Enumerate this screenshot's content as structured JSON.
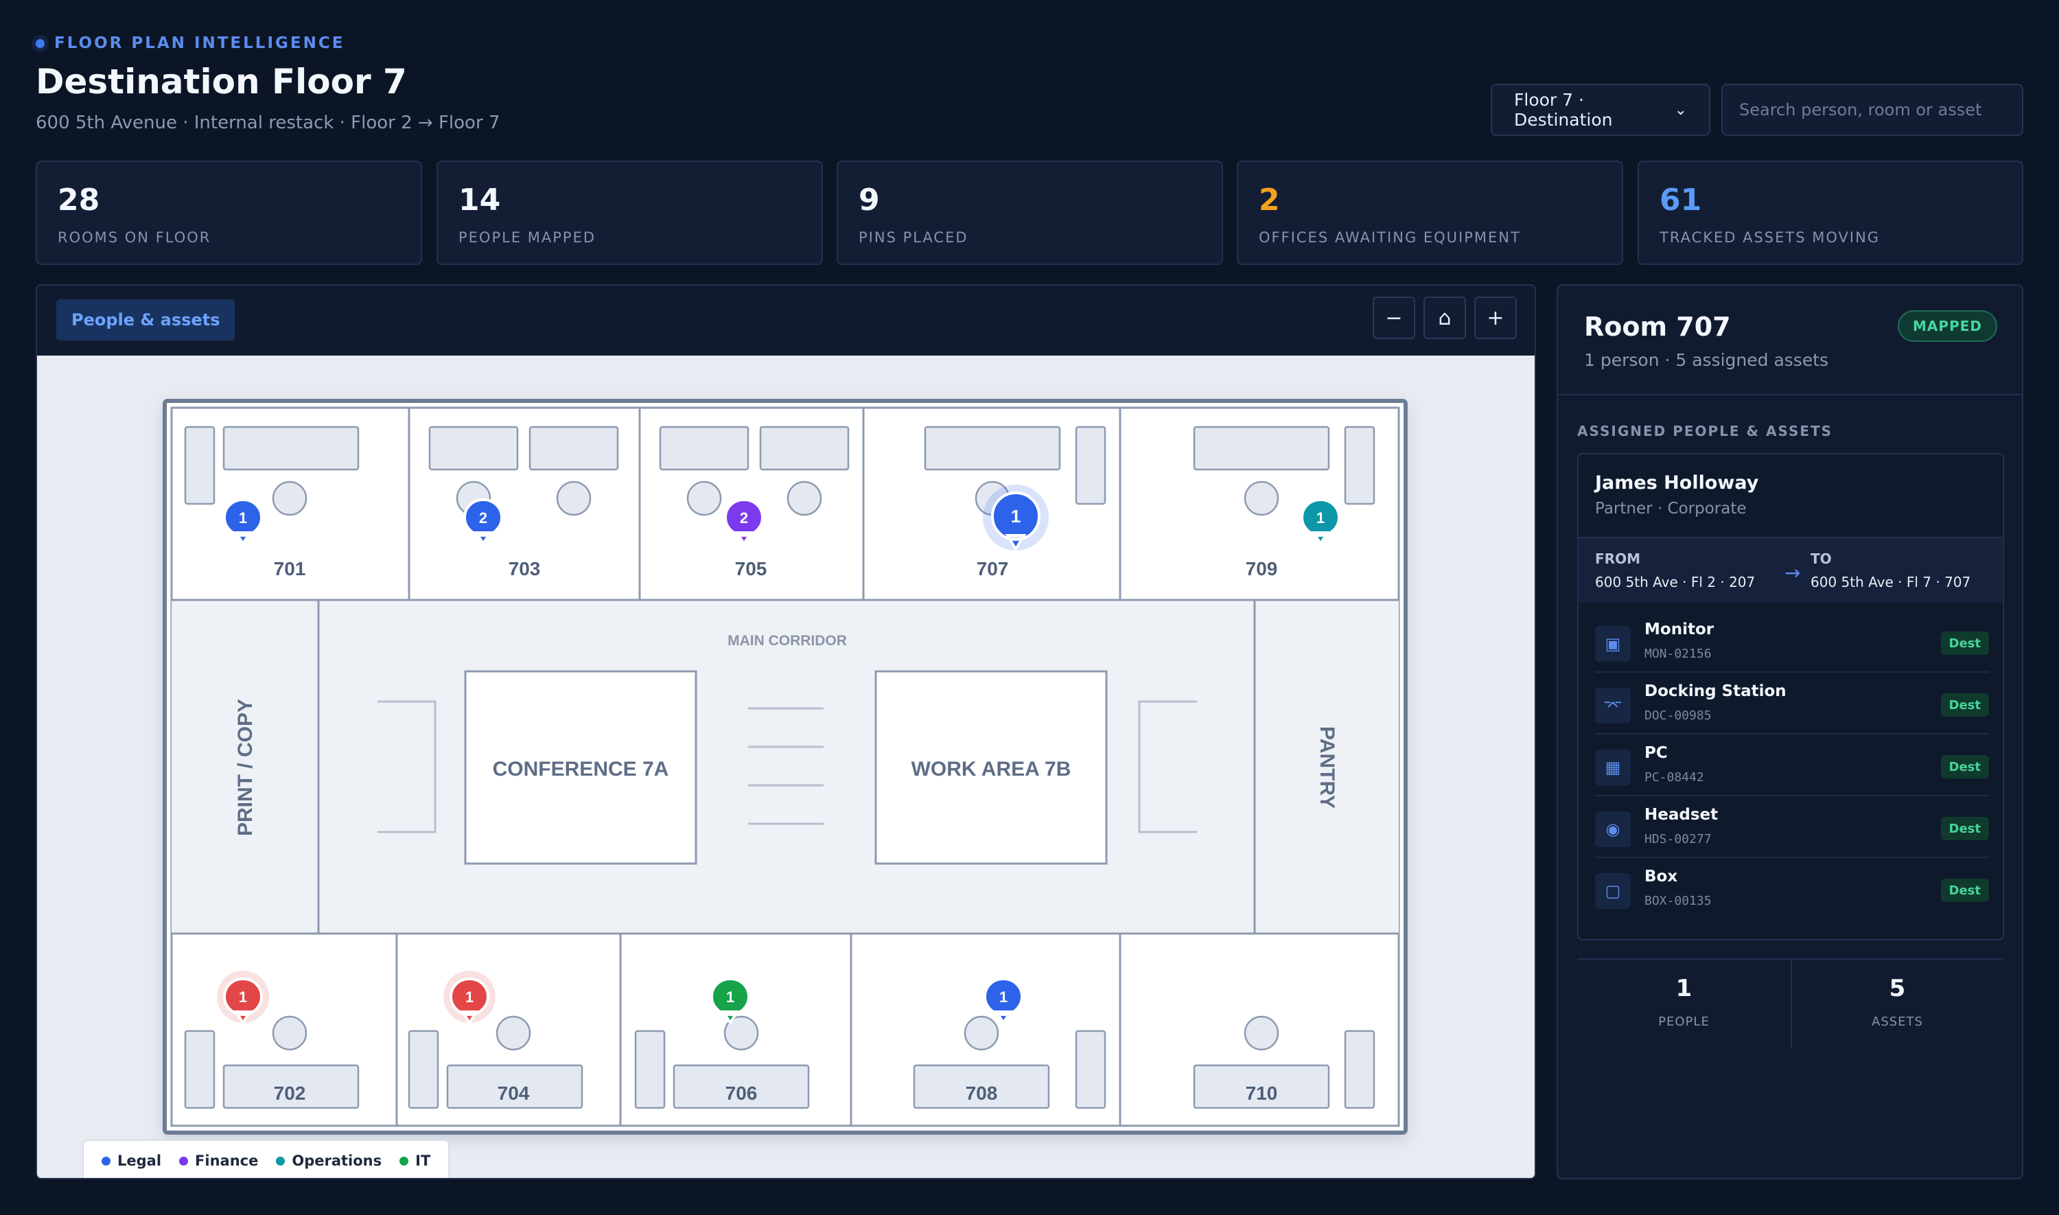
{
  "header": {
    "eyebrow": "FLOOR PLAN INTELLIGENCE",
    "title": "Destination Floor 7",
    "subtitle": "600 5th Avenue · Internal restack · Floor 2 → Floor 7",
    "floor_select": "Floor 7 · Destination",
    "search_placeholder": "Search person, room or asset"
  },
  "stats": [
    {
      "value": "28",
      "label": "ROOMS ON FLOOR",
      "color": "#f3f6fb"
    },
    {
      "value": "14",
      "label": "PEOPLE MAPPED",
      "color": "#f3f6fb"
    },
    {
      "value": "9",
      "label": "PINS PLACED",
      "color": "#f3f6fb"
    },
    {
      "value": "2",
      "label": "OFFICES AWAITING EQUIPMENT",
      "color": "#f3a21c"
    },
    {
      "value": "61",
      "label": "TRACKED ASSETS MOVING",
      "color": "#5b9bf5"
    }
  ],
  "map": {
    "tab_label": "People & assets",
    "zoom_out": "−",
    "home": "⌂",
    "zoom_in": "+",
    "rooms_top": [
      "701",
      "703",
      "705",
      "707",
      "709"
    ],
    "rooms_bottom": [
      "702",
      "704",
      "706",
      "708",
      "710"
    ],
    "left_room": "PRINT / COPY",
    "right_room": "PANTRY",
    "corridor": "MAIN CORRIDOR",
    "conference": "CONFERENCE 7A",
    "work_area": "WORK AREA 7B",
    "pins": [
      {
        "room": "701",
        "count": "1",
        "dept": "Legal"
      },
      {
        "room": "703",
        "count": "2",
        "dept": "Legal"
      },
      {
        "room": "705",
        "count": "2",
        "dept": "Finance"
      },
      {
        "room": "707",
        "count": "1",
        "dept": "Legal",
        "selected": true
      },
      {
        "room": "709",
        "count": "1",
        "dept": "Operations"
      },
      {
        "room": "702",
        "count": "1",
        "dept": "Awaiting"
      },
      {
        "room": "704",
        "count": "1",
        "dept": "Awaiting"
      },
      {
        "room": "706",
        "count": "1",
        "dept": "IT"
      },
      {
        "room": "708",
        "count": "1",
        "dept": "Legal"
      }
    ],
    "legend": [
      {
        "label": "Legal",
        "color": "#2c63e8"
      },
      {
        "label": "Finance",
        "color": "#7c3aed"
      },
      {
        "label": "Operations",
        "color": "#0e97a8"
      },
      {
        "label": "IT",
        "color": "#16a34a"
      }
    ],
    "awaiting_color": "#e24646"
  },
  "detail": {
    "room_title": "Room 707",
    "status": "MAPPED",
    "room_sub": "1 person · 5 assigned assets",
    "section": "ASSIGNED PEOPLE & ASSETS",
    "person": {
      "name": "James Holloway",
      "role": "Partner · Corporate",
      "from_label": "FROM",
      "from": "600 5th Ave · Fl 2 · 207",
      "to_label": "TO",
      "to": "600 5th Ave · Fl 7 · 707"
    },
    "assets": [
      {
        "name": "Monitor",
        "code": "MON-02156",
        "tag": "Dest",
        "icon": "monitor-icon"
      },
      {
        "name": "Docking Station",
        "code": "DOC-00985",
        "tag": "Dest",
        "icon": "dock-icon"
      },
      {
        "name": "PC",
        "code": "PC-08442",
        "tag": "Dest",
        "icon": "pc-icon"
      },
      {
        "name": "Headset",
        "code": "HDS-00277",
        "tag": "Dest",
        "icon": "headset-icon"
      },
      {
        "name": "Box",
        "code": "BOX-00135",
        "tag": "Dest",
        "icon": "box-icon"
      }
    ],
    "totals": {
      "people_value": "1",
      "people_label": "PEOPLE",
      "assets_value": "5",
      "assets_label": "ASSETS"
    }
  }
}
